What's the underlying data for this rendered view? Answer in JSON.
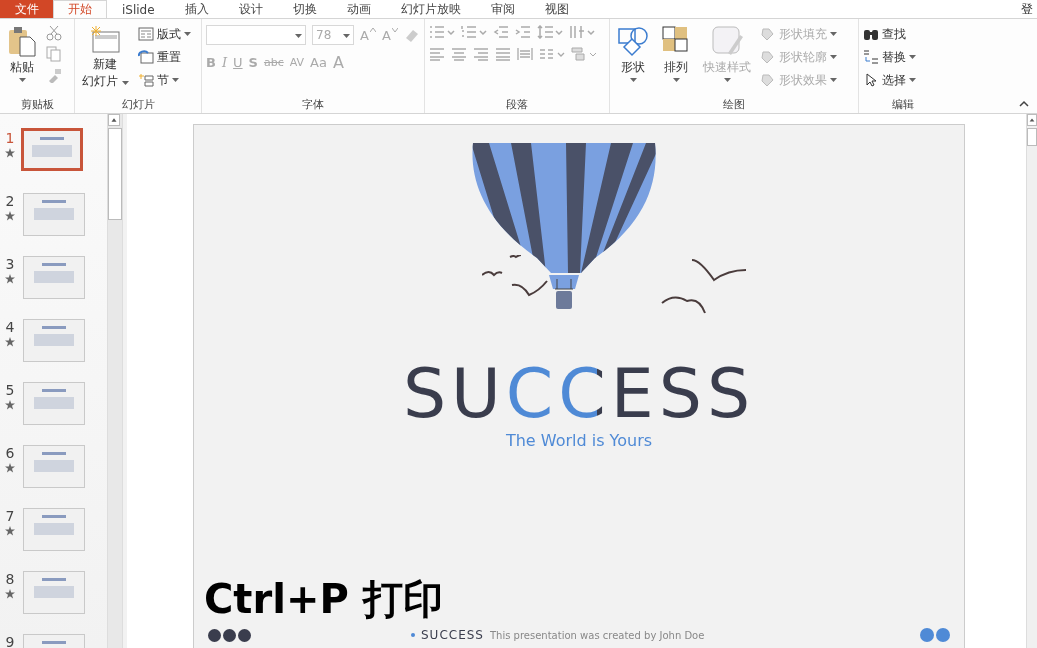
{
  "file_tab": "文件",
  "tabs": [
    {
      "label": "开始",
      "selected": true
    },
    {
      "label": "iSlide",
      "selected": false
    },
    {
      "label": "插入",
      "selected": false
    },
    {
      "label": "设计",
      "selected": false
    },
    {
      "label": "切换",
      "selected": false
    },
    {
      "label": "动画",
      "selected": false
    },
    {
      "label": "幻灯片放映",
      "selected": false
    },
    {
      "label": "审阅",
      "selected": false
    },
    {
      "label": "视图",
      "selected": false
    }
  ],
  "account": "登",
  "ribbon": {
    "clipboard": {
      "label": "剪贴板",
      "paste": "粘贴"
    },
    "slides": {
      "label": "幻灯片",
      "new_slide": [
        "新建",
        "幻灯片"
      ],
      "layout": "版式",
      "reset": "重置",
      "section": "节"
    },
    "font": {
      "label": "字体",
      "size": "78",
      "grow": "A",
      "shrink": "A",
      "format_buttons": [
        "B",
        "I",
        "U",
        "S",
        "abc",
        "AV",
        "Aa",
        "A"
      ]
    },
    "paragraph": {
      "label": "段落"
    },
    "drawing": {
      "label": "绘图",
      "shapes": "形状",
      "arrange": "排列",
      "quick_styles": {
        "label": "快速样式",
        "disabled": true
      },
      "shape_commands": [
        {
          "label": "形状填充",
          "disabled": true
        },
        {
          "label": "形状轮廓",
          "disabled": true
        },
        {
          "label": "形状效果",
          "disabled": true
        }
      ]
    },
    "editing": {
      "label": "编辑",
      "find": "查找",
      "replace": "替换",
      "select": "选择"
    }
  },
  "slides": [
    {
      "number": "1",
      "selected": true
    },
    {
      "number": "2",
      "selected": false
    },
    {
      "number": "3",
      "selected": false
    },
    {
      "number": "4",
      "selected": false
    },
    {
      "number": "5",
      "selected": false
    },
    {
      "number": "6",
      "selected": false
    },
    {
      "number": "7",
      "selected": false
    },
    {
      "number": "8",
      "selected": false
    },
    {
      "number": "9",
      "selected": false
    }
  ],
  "slide": {
    "title": "SUCCESS",
    "subtitle": "The World is Yours",
    "footer_title": "SUCCESS",
    "footer_text": "This presentation was created by John Doe"
  },
  "caption": "Ctrl+P 打印"
}
